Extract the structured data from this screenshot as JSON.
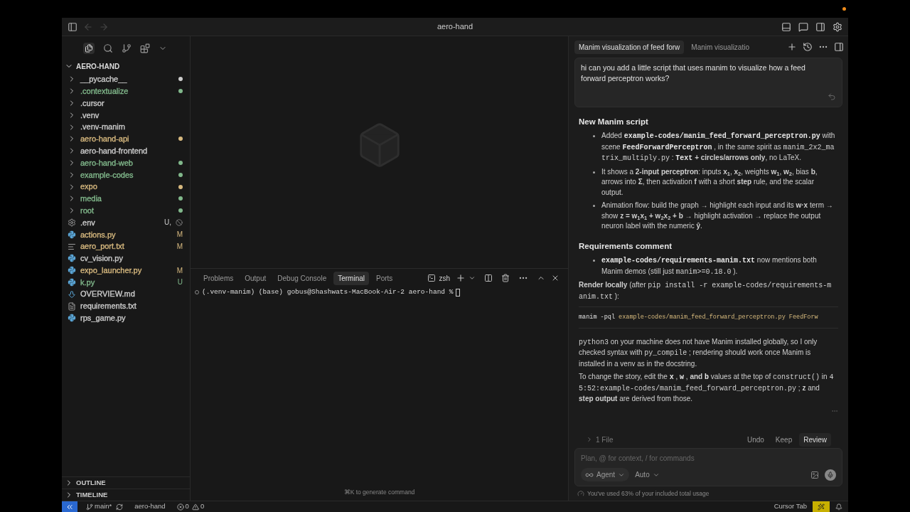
{
  "window": {
    "title": "aero-hand"
  },
  "explorer": {
    "root": "AERO-HAND",
    "items": [
      {
        "name": "__pycache__",
        "kind": "folder",
        "color": "#cccccc",
        "dot": true
      },
      {
        "name": ".contextualize",
        "kind": "folder",
        "color": "#81b88b",
        "dot": true
      },
      {
        "name": ".cursor",
        "kind": "folder",
        "color": "#cccccc",
        "dot": false
      },
      {
        "name": ".venv",
        "kind": "folder",
        "color": "#cccccc",
        "dot": false
      },
      {
        "name": ".venv-manim",
        "kind": "folder",
        "color": "#cccccc",
        "dot": false
      },
      {
        "name": "aero-hand-api",
        "kind": "folder",
        "color": "#d7b97f",
        "dot": true
      },
      {
        "name": "aero-hand-frontend",
        "kind": "folder",
        "color": "#cccccc",
        "dot": false
      },
      {
        "name": "aero-hand-web",
        "kind": "folder",
        "color": "#81b88b",
        "dot": true
      },
      {
        "name": "example-codes",
        "kind": "folder",
        "color": "#81b88b",
        "dot": true
      },
      {
        "name": "expo",
        "kind": "folder",
        "color": "#d7b97f",
        "dot": true
      },
      {
        "name": "media",
        "kind": "folder",
        "color": "#81b88b",
        "dot": true
      },
      {
        "name": "root",
        "kind": "folder",
        "color": "#81b88b",
        "dot": true
      },
      {
        "name": ".env",
        "kind": "settings",
        "color": "#cccccc",
        "dot": false,
        "badge": "U,",
        "ignored": true
      },
      {
        "name": "actions.py",
        "kind": "python",
        "color": "#d7b97f",
        "dot": false,
        "badge": "M"
      },
      {
        "name": "aero_port.txt",
        "kind": "text",
        "color": "#d7b97f",
        "dot": false,
        "badge": "M"
      },
      {
        "name": "cv_vision.py",
        "kind": "python",
        "color": "#cccccc",
        "dot": false
      },
      {
        "name": "expo_launcher.py",
        "kind": "python",
        "color": "#d7b97f",
        "dot": false,
        "badge": "M"
      },
      {
        "name": "k.py",
        "kind": "python",
        "color": "#81b88b",
        "dot": false,
        "badge": "U"
      },
      {
        "name": "OVERVIEW.md",
        "kind": "markdown",
        "color": "#cccccc",
        "dot": false
      },
      {
        "name": "requirements.txt",
        "kind": "list",
        "color": "#cccccc",
        "dot": false
      },
      {
        "name": "rps_game.py",
        "kind": "python",
        "color": "#cccccc",
        "dot": false
      }
    ],
    "sections": [
      {
        "label": "OUTLINE",
        "expanded": false
      },
      {
        "label": "TIMELINE",
        "expanded": false
      }
    ]
  },
  "panel": {
    "tabs": [
      {
        "label": "Problems",
        "selected": false
      },
      {
        "label": "Output",
        "selected": false
      },
      {
        "label": "Debug Console",
        "selected": false
      },
      {
        "label": "Terminal",
        "selected": true
      },
      {
        "label": "Ports",
        "selected": false
      }
    ],
    "shell": "zsh",
    "prompt": "(.venv-manim) (base) gobus@Shashwats-MacBook-Air-2 aero-hand %",
    "hint": "⌘K to generate command"
  },
  "chat": {
    "tabs": [
      {
        "label": "Manim visualization of feed forw",
        "selected": true
      },
      {
        "label": "Manim visualizatio",
        "selected": false
      }
    ],
    "user_message": "hi can you add a little script that uses manim to visualize how a feed forward perceptron works?",
    "blocks": [
      {
        "kind": "heading",
        "text": "New Manim script"
      },
      {
        "kind": "bullet",
        "segments": [
          {
            "kind": "text",
            "text": "Added "
          },
          {
            "kind": "code_bold",
            "text": "example-codes/manim_feed_forward_perceptron.py"
          },
          {
            "kind": "text",
            "text": " with scene "
          },
          {
            "kind": "code_bold",
            "text": "FeedForwardPerceptron"
          },
          {
            "kind": "text",
            "text": " , in the same spirit as "
          },
          {
            "kind": "code",
            "text": "manim_2x2_matrix_multiply.py"
          },
          {
            "kind": "text",
            "text": " : "
          },
          {
            "kind": "code_bold",
            "text": "Text"
          },
          {
            "kind": "text",
            "text": " **+ circles/arrows only**, no LaTeX."
          }
        ]
      },
      {
        "kind": "bullet",
        "segments": [
          {
            "kind": "text",
            "text": "It shows a **2-input perceptron**: inputs **x$_{1}$**, **x$_{2}$**, weights **w$_{1}$**, **w$_{2}$**, bias **b**, arrows into **Σ**, then activation **f** with a short **step** rule, and the scalar output."
          }
        ]
      },
      {
        "kind": "bullet",
        "segments": [
          {
            "kind": "text",
            "text": "Animation flow: build the graph → highlight each input and its **w·x** term → show **z = w$_{1}$x$_{1}$ + w$_{2}$x$_{2}$ + b** → highlight activation → replace the output neuron label with the numeric **ŷ**."
          }
        ]
      },
      {
        "kind": "heading",
        "text": "Requirements comment"
      },
      {
        "kind": "bullet",
        "segments": [
          {
            "kind": "code_bold",
            "text": "example-codes/requirements-manim.txt"
          },
          {
            "kind": "text",
            "text": " now mentions both Manim demos (still just "
          },
          {
            "kind": "code",
            "text": "manim>=0.18.0"
          },
          {
            "kind": "text",
            "text": " )."
          }
        ]
      },
      {
        "kind": "paragraph",
        "segments": [
          {
            "kind": "text",
            "text": "**Render locally** (after "
          },
          {
            "kind": "code",
            "text": "pip install -r example-codes/requirements-manim.txt"
          },
          {
            "kind": "text",
            "text": " ):"
          }
        ]
      },
      {
        "kind": "codeblock",
        "segments": [
          {
            "kind": "command",
            "text": "manim -pql"
          },
          {
            "kind": "arg",
            "text": " example-codes/manim_feed_forward_perceptron.py FeedForw"
          }
        ]
      },
      {
        "kind": "paragraph",
        "segments": [
          {
            "kind": "code",
            "text": "python3"
          },
          {
            "kind": "text",
            "text": " on your machine does not have Manim installed globally, so I only checked syntax with "
          },
          {
            "kind": "code",
            "text": "py_compile"
          },
          {
            "kind": "text",
            "text": " ; rendering should work once Manim is installed in a venv as in the docstring."
          }
        ]
      },
      {
        "kind": "paragraph",
        "segments": [
          {
            "kind": "text",
            "text": "To change the story, edit the "
          },
          {
            "kind": "code_bold",
            "text": "x"
          },
          {
            "kind": "text",
            "text": " , "
          },
          {
            "kind": "code_bold",
            "text": "w"
          },
          {
            "kind": "text",
            "text": " , **and** "
          },
          {
            "kind": "code_bold",
            "text": "b"
          },
          {
            "kind": "text",
            "text": " values at the top of "
          },
          {
            "kind": "code",
            "text": "construct()"
          },
          {
            "kind": "text",
            "text": " in "
          },
          {
            "kind": "code",
            "text": "45:52:example-codes/manim_feed_forward_perceptron.py"
          },
          {
            "kind": "text",
            "text": " ; **z** and **step output** are derived from those."
          }
        ]
      }
    ],
    "review": {
      "files": "1 File",
      "buttons": [
        "Undo",
        "Keep",
        "Review"
      ]
    },
    "input": {
      "placeholder": "Plan, @ for context, / for commands",
      "mode": "Agent",
      "model": "Auto"
    },
    "usage": "You've used 63% of your included total usage"
  },
  "status_bar": {
    "branch": "main*",
    "project": "aero-hand",
    "errors": "0",
    "warnings": "0",
    "cursor_tab": "Cursor Tab"
  }
}
